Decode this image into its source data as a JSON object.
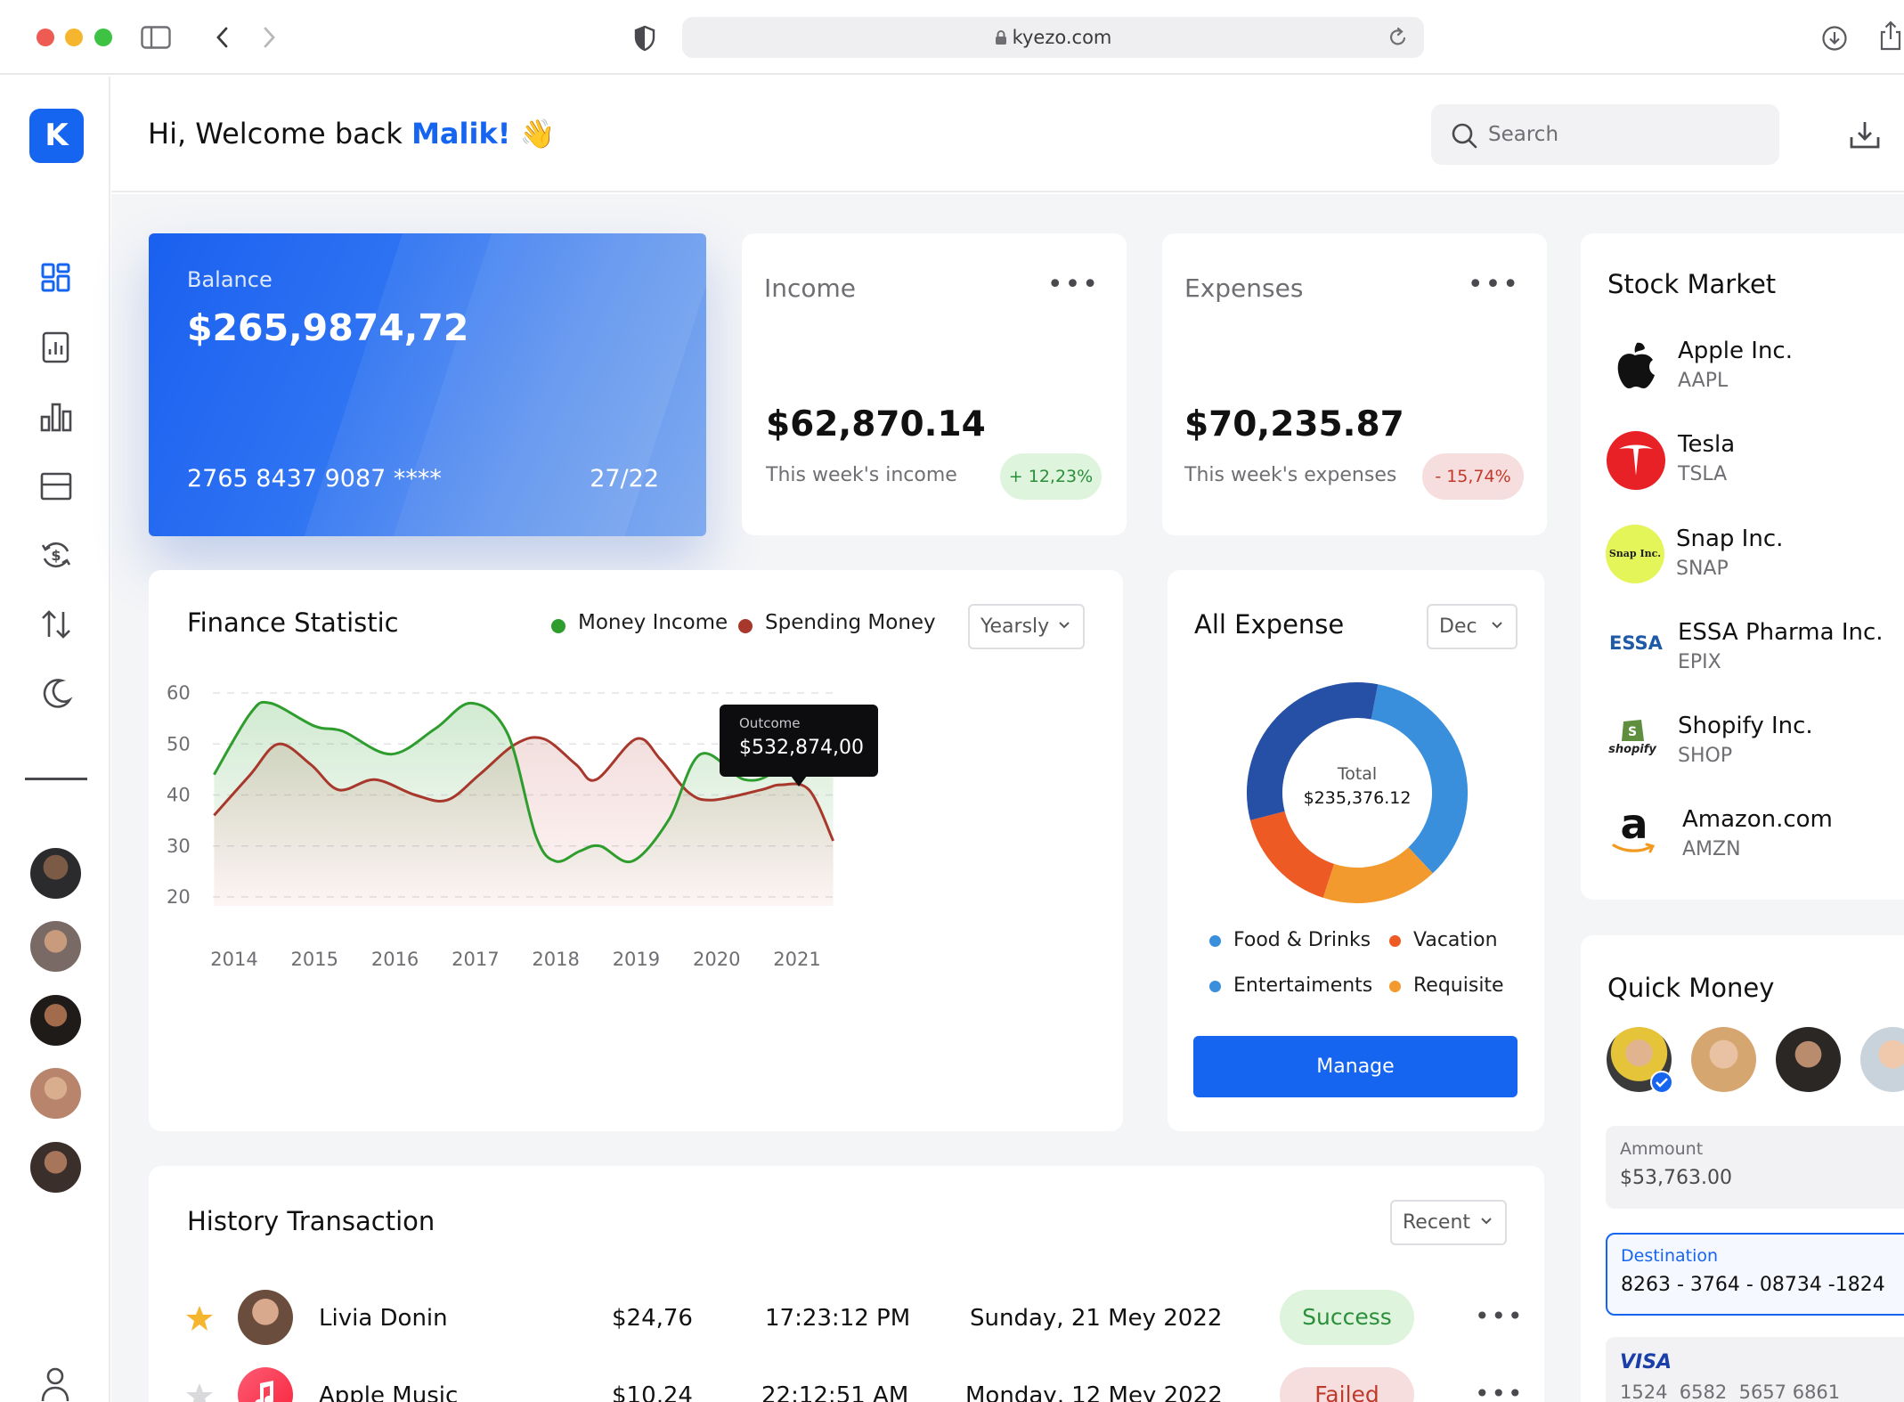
{
  "browser": {
    "url": "kyezo.com",
    "traffic_lights": [
      "#ee5b53",
      "#f5b52e",
      "#3ec244"
    ]
  },
  "app": {
    "logo_letter": "K",
    "accent": "#1565f0",
    "greeting_prefix": "Hi, Welcome back ",
    "user_name": "Malik!",
    "greeting_emoji": "👋",
    "search_placeholder": "Search",
    "nav_icons": [
      "dashboard-icon",
      "report-icon",
      "bar-chart-icon",
      "wallet-icon",
      "exchange-icon",
      "transfer-icon",
      "dark-mode-icon"
    ]
  },
  "balance_card": {
    "label": "Balance",
    "amount": "$265,9874,72",
    "card_number": "2765 8437 9087 ****",
    "expiry": "27/22"
  },
  "income": {
    "title": "Income",
    "amount": "$62,870.14",
    "caption": "This week's income",
    "change": "+ 12,23%",
    "change_color": "#2a8f3a"
  },
  "expenses": {
    "title": "Expenses",
    "amount": "$70,235.87",
    "caption": "This week's expenses",
    "change": "- 15,74%",
    "change_color": "#c0392b"
  },
  "finance_statistic": {
    "title": "Finance Statistic",
    "legend": [
      {
        "label": "Money Income",
        "color": "#2e9d2e"
      },
      {
        "label": "Spending Money",
        "color": "#a8372c"
      }
    ],
    "filter": "Yearsly",
    "tooltip_label": "Outcome",
    "tooltip_value": "$532,874,00"
  },
  "chart_data": {
    "type": "line",
    "x": [
      2014,
      2015,
      2016,
      2017,
      2018,
      2019,
      2020,
      2021
    ],
    "x_ticks": [
      "2014",
      "2015",
      "2016",
      "2017",
      "2018",
      "2019",
      "2020",
      "2021"
    ],
    "y_ticks": [
      "60",
      "50",
      "40",
      "30",
      "20"
    ],
    "ylim": [
      20,
      60
    ],
    "grid": true,
    "series": [
      {
        "name": "Money Income",
        "color": "#2e9d2e",
        "points": [
          [
            2013.75,
            44
          ],
          [
            2014.2,
            56
          ],
          [
            2014.45,
            58
          ],
          [
            2015.0,
            53.5
          ],
          [
            2015.35,
            52.5
          ],
          [
            2015.95,
            48
          ],
          [
            2016.5,
            53
          ],
          [
            2016.95,
            58
          ],
          [
            2017.4,
            52
          ],
          [
            2017.75,
            32
          ],
          [
            2018.0,
            27
          ],
          [
            2018.3,
            29
          ],
          [
            2018.55,
            30
          ],
          [
            2018.95,
            27
          ],
          [
            2019.4,
            35
          ],
          [
            2019.8,
            48
          ],
          [
            2020.35,
            43
          ],
          [
            2020.75,
            45
          ],
          [
            2021.2,
            53
          ],
          [
            2021.45,
            56
          ]
        ]
      },
      {
        "name": "Spending Money",
        "color": "#a8372c",
        "points": [
          [
            2013.75,
            36
          ],
          [
            2014.2,
            44
          ],
          [
            2014.55,
            50
          ],
          [
            2014.95,
            46
          ],
          [
            2015.3,
            41
          ],
          [
            2015.75,
            43
          ],
          [
            2016.25,
            40
          ],
          [
            2016.65,
            39
          ],
          [
            2017.05,
            44
          ],
          [
            2017.5,
            50
          ],
          [
            2017.85,
            51
          ],
          [
            2018.25,
            46
          ],
          [
            2018.5,
            43
          ],
          [
            2019.0,
            51
          ],
          [
            2019.3,
            47
          ],
          [
            2019.65,
            40.5
          ],
          [
            2019.95,
            39
          ],
          [
            2020.55,
            41
          ],
          [
            2020.8,
            42
          ],
          [
            2021.15,
            41
          ],
          [
            2021.45,
            31
          ]
        ]
      }
    ]
  },
  "all_expense": {
    "title": "All Expense",
    "filter": "Dec",
    "total_label": "Total",
    "total_value": "$235,376.12",
    "segments": [
      {
        "label": "Entertaiments",
        "color": "#3a8fdd",
        "value": 35
      },
      {
        "label": "Requisite",
        "color": "#f39a2e",
        "value": 17
      },
      {
        "label": "Vacation",
        "color": "#ee5a24",
        "value": 16
      },
      {
        "label": "Food & Drinks",
        "color": "#2650a6",
        "value": 32
      }
    ],
    "legend": [
      {
        "label": "Food & Drinks",
        "color": "#3a8fdd"
      },
      {
        "label": "Vacation",
        "color": "#ee5a24"
      },
      {
        "label": "Entertaiments",
        "color": "#3a8fdd"
      },
      {
        "label": "Requisite",
        "color": "#f39a2e"
      }
    ],
    "button": "Manage"
  },
  "stock_market": {
    "title": "Stock Market",
    "items": [
      {
        "name": "Apple Inc.",
        "symbol": "AAPL"
      },
      {
        "name": "Tesla",
        "symbol": "TSLA"
      },
      {
        "name": "Snap Inc.",
        "symbol": "SNAP",
        "logo_text": "Snap Inc."
      },
      {
        "name": "ESSA Pharma Inc.",
        "symbol": "EPIX",
        "logo_text": "ESSA"
      },
      {
        "name": "Shopify Inc.",
        "symbol": "SHOP",
        "logo_text": "shopify"
      },
      {
        "name": "Amazon.com",
        "symbol": "AMZN",
        "logo_text": "a"
      }
    ]
  },
  "history": {
    "title": "History Transaction",
    "filter": "Recent",
    "rows": [
      {
        "name": "Livia Donin",
        "amount": "$24,76",
        "time": "17:23:12 PM",
        "date": "Sunday, 21 Mey 2022",
        "status": "Success"
      },
      {
        "name": "Apple Music",
        "amount": "$10,24",
        "time": "22:12:51 AM",
        "date": "Monday, 12 Mey 2022",
        "status": "Failed"
      }
    ]
  },
  "quick_money": {
    "title": "Quick Money",
    "amount_label": "Ammount",
    "amount_value": "$53,763.00",
    "destination_label": "Destination",
    "destination_value": "8263 - 3764 - 08734 -1824",
    "card_brand": "VISA",
    "card_number": "1524  6582  5657 6861"
  }
}
